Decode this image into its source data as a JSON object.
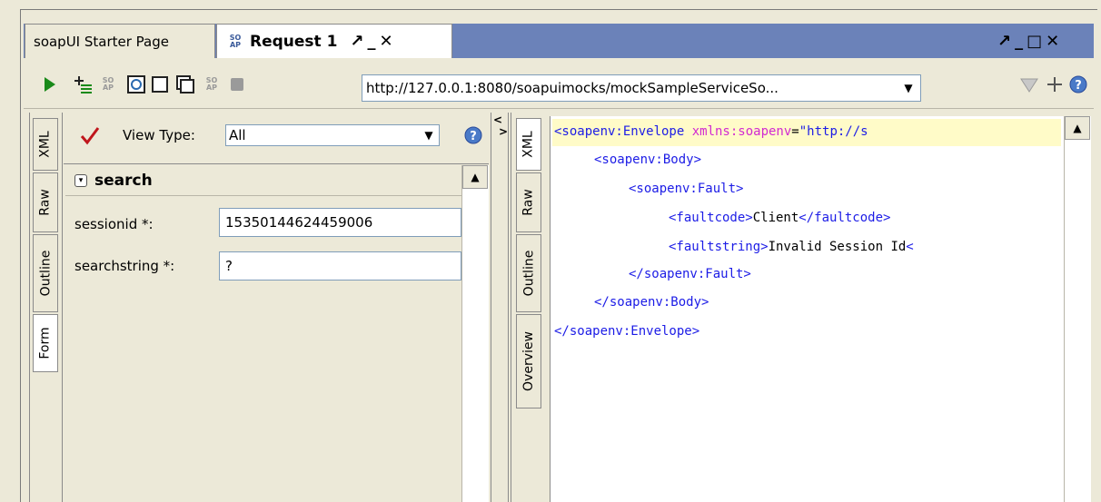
{
  "tabs": [
    {
      "label": "soapUI Starter Page"
    },
    {
      "label": "Request 1",
      "icon": "soap-icon"
    }
  ],
  "window_controls": {
    "float": "↗",
    "minimize": "_",
    "maximize": "□",
    "close": "✕"
  },
  "toolbar": {
    "endpoint_url": "http://127.0.0.1:8080/soapuimocks/mockSampleServiceSo...",
    "icons": [
      "run-icon",
      "add-assertion-icon",
      "soap-icon",
      "aut-icon",
      "split-view-icon",
      "split-tabs-icon",
      "soap-icon",
      "stop-icon",
      "ws-a-icon",
      "add-icon",
      "help-icon"
    ]
  },
  "left_vtabs": [
    "XML",
    "Raw",
    "Outline",
    "Form"
  ],
  "right_vtabs": [
    "XML",
    "Raw",
    "Outline",
    "Overview"
  ],
  "form": {
    "view_type_label": "View Type:",
    "view_type_value": "All",
    "section_title": "search",
    "fields": [
      {
        "label": "sessionid *:",
        "value": "15350144624459006"
      },
      {
        "label": "searchstring *:",
        "value": "?"
      }
    ]
  },
  "response_xml": {
    "line1_tag": "<soapenv:Envelope ",
    "line1_attr": "xmlns:soapenv",
    "line1_eq": "=",
    "line1_val": "\"http://s",
    "line2": "<soapenv:Body>",
    "line3": "<soapenv:Fault>",
    "line4_open": "<faultcode>",
    "line4_text": "Client",
    "line4_close": "</faultcode>",
    "line5_open": "<faultstring>",
    "line5_text": "Invalid Session Id",
    "line5_close": "<",
    "line6": "</soapenv:Fault>",
    "line7": "</soapenv:Body>",
    "line8": "</soapenv:Envelope>"
  },
  "colors": {
    "tabbar_bg": "#6b82b9",
    "panel_bg": "#ece9d8",
    "xml_tag": "#1c1ce6",
    "xml_attr": "#d12ad1",
    "current_line": "#fffbc8"
  }
}
